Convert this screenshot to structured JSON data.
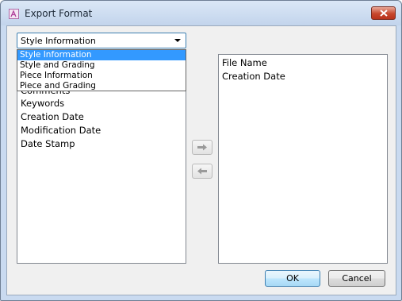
{
  "window": {
    "title": "Export Format"
  },
  "icons": {
    "app": "app-icon",
    "close": "close-icon",
    "move_right": "arrow-right-icon",
    "move_left": "arrow-left-icon",
    "dropdown": "chevron-down-icon"
  },
  "combo": {
    "selected": "Style Information",
    "options": [
      "Style Information",
      "Style and Grading",
      "Piece Information",
      "Piece and Grading"
    ]
  },
  "left_list": {
    "items": [
      "Comments",
      "Keywords",
      "Creation Date",
      "Modification Date",
      "Date Stamp"
    ]
  },
  "right_list": {
    "items": [
      "File Name",
      "Creation Date"
    ]
  },
  "buttons": {
    "ok": "OK",
    "cancel": "Cancel"
  },
  "colors": {
    "selection": "#3399ff",
    "close_button": "#c7472c",
    "titlebar": "#c9daf0"
  }
}
